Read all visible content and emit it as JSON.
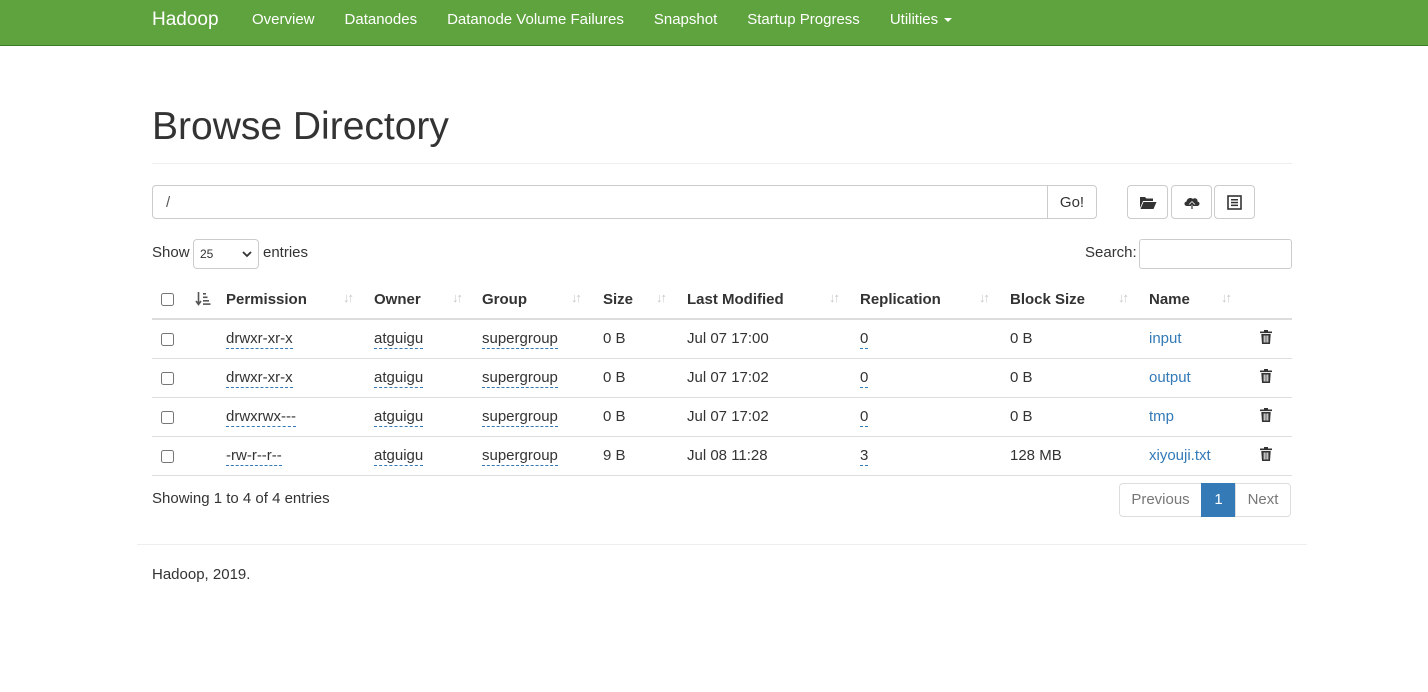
{
  "nav": {
    "brand": "Hadoop",
    "items": [
      {
        "label": "Overview"
      },
      {
        "label": "Datanodes"
      },
      {
        "label": "Datanode Volume Failures"
      },
      {
        "label": "Snapshot"
      },
      {
        "label": "Startup Progress"
      },
      {
        "label": "Utilities"
      }
    ],
    "bar_color": "#5fa33e"
  },
  "page": {
    "title": "Browse Directory"
  },
  "path_bar": {
    "value": "/",
    "go_label": "Go!",
    "icons": [
      "folder-open-icon",
      "cloud-upload-icon",
      "list-alt-icon"
    ]
  },
  "controls": {
    "show_label": "Show",
    "page_length": "25",
    "entries_label": "entries",
    "search_label": "Search:",
    "search_value": ""
  },
  "table": {
    "columns": [
      "Permission",
      "Owner",
      "Group",
      "Size",
      "Last Modified",
      "Replication",
      "Block Size",
      "Name"
    ],
    "rows": [
      {
        "permission": "drwxr-xr-x",
        "owner": "atguigu",
        "group": "supergroup",
        "size": "0 B",
        "modified": "Jul 07 17:00",
        "replication": "0",
        "block_size": "0 B",
        "name": "input"
      },
      {
        "permission": "drwxr-xr-x",
        "owner": "atguigu",
        "group": "supergroup",
        "size": "0 B",
        "modified": "Jul 07 17:02",
        "replication": "0",
        "block_size": "0 B",
        "name": "output"
      },
      {
        "permission": "drwxrwx---",
        "owner": "atguigu",
        "group": "supergroup",
        "size": "0 B",
        "modified": "Jul 07 17:02",
        "replication": "0",
        "block_size": "0 B",
        "name": "tmp"
      },
      {
        "permission": "-rw-r--r--",
        "owner": "atguigu",
        "group": "supergroup",
        "size": "9 B",
        "modified": "Jul 08 11:28",
        "replication": "3",
        "block_size": "128 MB",
        "name": "xiyouji.txt"
      }
    ]
  },
  "info": "Showing 1 to 4 of 4 entries",
  "pagination": {
    "previous": "Previous",
    "current": "1",
    "next": "Next",
    "accent": "#337ab7"
  },
  "footer": "Hadoop, 2019."
}
